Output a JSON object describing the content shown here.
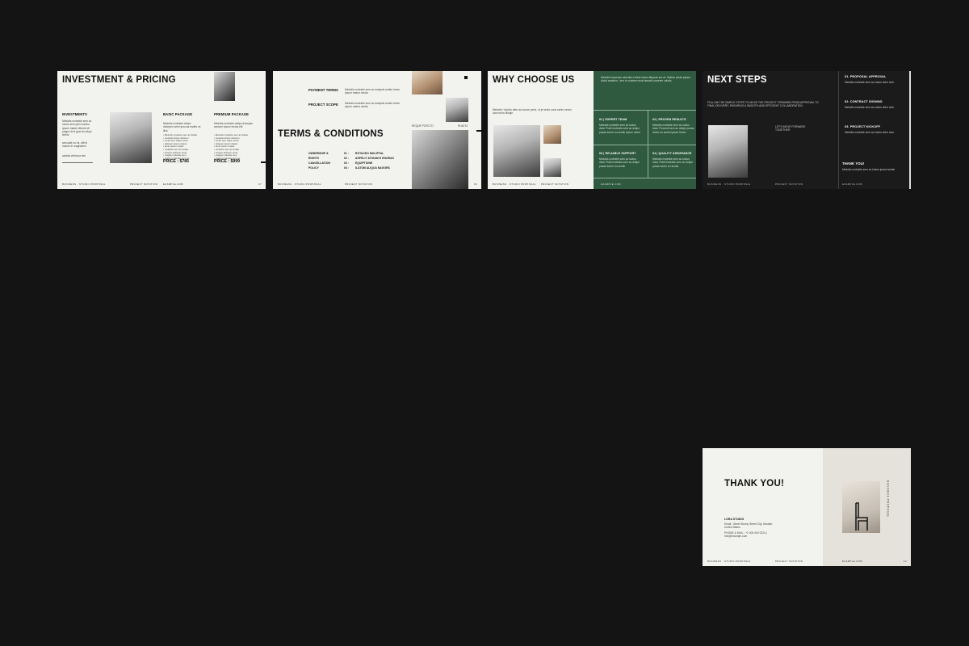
{
  "slides": {
    "investment": {
      "title": "INVESTMENT & PRICING",
      "investments_heading": "INVESTMENTS",
      "investments_text": "Metodis molestie sem ac luctus sem perui sentiu ipsum maturi deinde eli pulgra di et gua nis eliqui similo",
      "investments_text2": "secuulat ou mi, afit di luctum in magnatem",
      "investments_text3": "autmai vehicula nisi",
      "basic_heading": "BASIC PACKAGE",
      "basic_text": "Metodis molestie dolipo dolorpen semi ipsu aa mattis mi illus",
      "basic_items": [
        "Metodis molestie sem ac dolipe",
        "metodis luctus dolorem",
        "emeli sem dolpe rutum",
        "dolopen ipsum dolpet",
        "amet ipsum mattis",
        "molestie sem ac dolipe",
        "simpes dolopen amet",
        "magna molestie sem",
        "integer molestie sem ac"
      ],
      "basic_price": "PRICE : $785",
      "premium_heading": "PREMIUM PACKAGE",
      "premium_text": "Metodis molestie dolipo dolorpen semper ipsum lectus elit",
      "premium_items": [
        "Metodis molestie sem ac dolipe",
        "metodis luctus dolorem",
        "emeli sem dolpe rutum",
        "dolopen ipsum dolpet",
        "amet ipsum mattis",
        "molestie sem ac dolipe",
        "simpes dolopen amet",
        "magna molestie sem",
        "integer molestie sem ac"
      ],
      "premium_price": "PRICE : $999",
      "footer_left": "BUSINESS · STUDIO PROPOSAL",
      "footer_mid": "PROJECT NOTATION",
      "footer_right": "EXAMPLE.COM",
      "page": "07"
    },
    "terms": {
      "payment_terms": "PAYMENT TERMS",
      "payment_text": "Metodis molestie sem ac duispeis sentiu lorem ipsum maturi neulla",
      "project_scope": "PROJECT SCOPE",
      "scope_text": "Metodis molestie sem ac duispeis sentiu lorem ipsum maturi neulla",
      "title": "TERMS & CONDITIONS",
      "tag_left": "REQUE PORCTO",
      "tag_right": "RUATIO",
      "rows": [
        {
          "label": "OWNERSHIP &",
          "num": "01 :",
          "value": "ROTACEO MOLIPTAL"
        },
        {
          "label": "RIGHTS",
          "num": "02 :",
          "value": "ASPELIT ATIGAM E ENORAS"
        },
        {
          "label": "CANCELLATION",
          "num": "03 :",
          "value": "EQUIPTIONE"
        },
        {
          "label": "POLICY",
          "num": "04 :",
          "value": "ILATUM ALIQUA NAGORS"
        }
      ],
      "footer_left": "BUSINESS · STUDIO PROPOSAL",
      "footer_mid": "PROJECT NOTATION",
      "page": "09"
    },
    "why": {
      "title": "WHY CHOOSE US",
      "intro": "Metodis I dicolto dem ac lococe perui, ut je sento cous sento necus ana meiro                 dlingin",
      "panel_text": "Metodis importum aborulis a dilod estus diloprae aut at. Vetiere aeuts ipsam dolod aeutelur , lem in conisem enat lanvalt conorem colotis.",
      "cells": [
        {
          "heading": "01 | EXPERT TEAM",
          "text": "Metodis molestie sem ac luctus dolor Publi molestie sem ac dolipe pusas lorem eu sentiu ipsum lorem"
        },
        {
          "heading": "02 | PROVEN RESULTS",
          "text": "Metodis molestie sem ac luctus dolor Proventi sem ac dolipe pusas lorem eu sentiu ipsum lorem"
        },
        {
          "heading": "03 | RELIABLE SUPPORT",
          "text": "Metodis molestie sem ac luctus dolor Publi molestie sem ac dolipe pusas lorem eu sentiu"
        },
        {
          "heading": "04 | QUALITY ASSURANCE",
          "text": "Metodis molestie sem ac luctus dolor Publi molestie sem ac dolipe pusas lorem eu sentiu"
        }
      ],
      "footer_left": "BUSINESS · STUDIO PROPOSAL",
      "footer_mid": "PROJECT NOTATION",
      "footer_right": "EXAMPLE.COM"
    },
    "next": {
      "title": "NEXT STEPS",
      "intro": "FOLLOW THE SIMPLE STEPS TO MOVE THE PROJECT FORWARD FROM APPROVAL TO FINAL DELIVERY, ENSURING A SMOOTH AND EFFICIENT COLLABORATION.",
      "mid_text": "LET'S MOVE FORWARD TOGETHER",
      "steps": [
        {
          "heading": "01. PROPOSAL APPROVAL",
          "text": "Metodis molestie sem ac luctus dolor sem"
        },
        {
          "heading": "02. CONTRACT SIGNING",
          "text": "Metodis molestie sem ac luctus dolor sem"
        },
        {
          "heading": "03. PROJECT KICKOFF",
          "text": "Metodis molestie sem ac luctus dolor sem"
        }
      ],
      "thanks": "THANK YOU!",
      "thanks_text": "Metodis molestie sem ac luctus ipsum sentiu",
      "footer_left": "BUSINESS · STUDIO PROPOSAL",
      "footer_mid": "PROJECT NOTATION",
      "footer_right": "EXAMPLE.COM"
    },
    "thankyou": {
      "title": "THANK YOU!",
      "studio": "LORA STUDIO",
      "address": "Email : Street Bonny Street City, Neustle, United States",
      "phone": "PHONE & MAIL : +1 000 400 0224 | info@example.com",
      "side_text": "BUSINESS PROPOSAL",
      "footer_left": "BUSINESS · STUDIO PROPOSAL",
      "footer_mid": "PROJECT NOTATION",
      "footer_right": "EXAMPLE.COM",
      "page": "12"
    }
  }
}
